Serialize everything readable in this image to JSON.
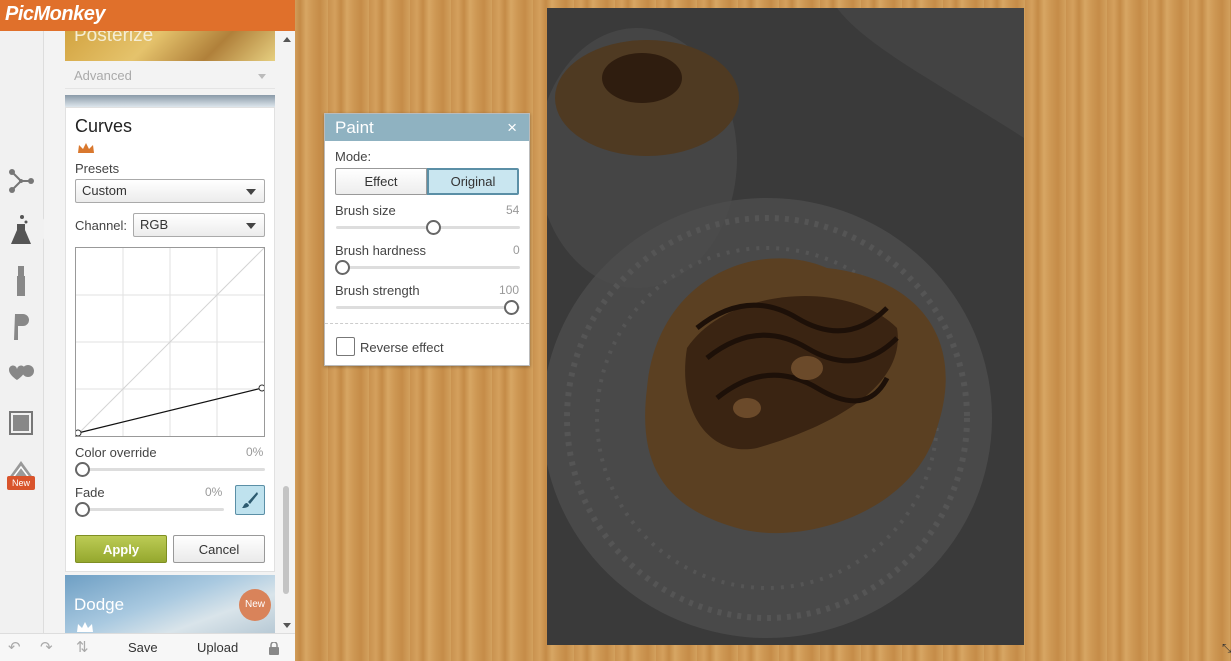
{
  "app": {
    "logo": "PicMonkey"
  },
  "rail": {
    "tools": [
      {
        "name": "basic-edits-icon"
      },
      {
        "name": "effects-icon"
      },
      {
        "name": "touch-up-icon"
      },
      {
        "name": "text-icon"
      },
      {
        "name": "overlays-icon"
      },
      {
        "name": "frames-icon"
      },
      {
        "name": "textures-icon"
      }
    ],
    "new_badge": "New"
  },
  "effects_panel": {
    "posterize_label": "Posterize",
    "advanced_label": "Advanced",
    "curves": {
      "title": "Curves",
      "presets_label": "Presets",
      "presets_value": "Custom",
      "channel_label": "Channel:",
      "channel_value": "RGB",
      "color_override_label": "Color override",
      "color_override_value": "0%",
      "fade_label": "Fade",
      "fade_value": "0%",
      "apply_label": "Apply",
      "cancel_label": "Cancel"
    },
    "dodge": {
      "label": "Dodge",
      "badge": "New"
    }
  },
  "bottom_toolbar": {
    "save_label": "Save",
    "upload_label": "Upload"
  },
  "paint_dialog": {
    "title": "Paint",
    "close": "×",
    "mode_label": "Mode:",
    "modes": [
      "Effect",
      "Original"
    ],
    "selected_mode": "Original",
    "brush_size_label": "Brush size",
    "brush_size_value": "54",
    "brush_hardness_label": "Brush hardness",
    "brush_hardness_value": "0",
    "brush_strength_label": "Brush strength",
    "brush_strength_value": "100",
    "reverse_label": "Reverse effect"
  },
  "colors": {
    "brand_orange": "#e0702b",
    "apply_green": "#a6b83c",
    "dialog_header": "#8fb2c1"
  }
}
